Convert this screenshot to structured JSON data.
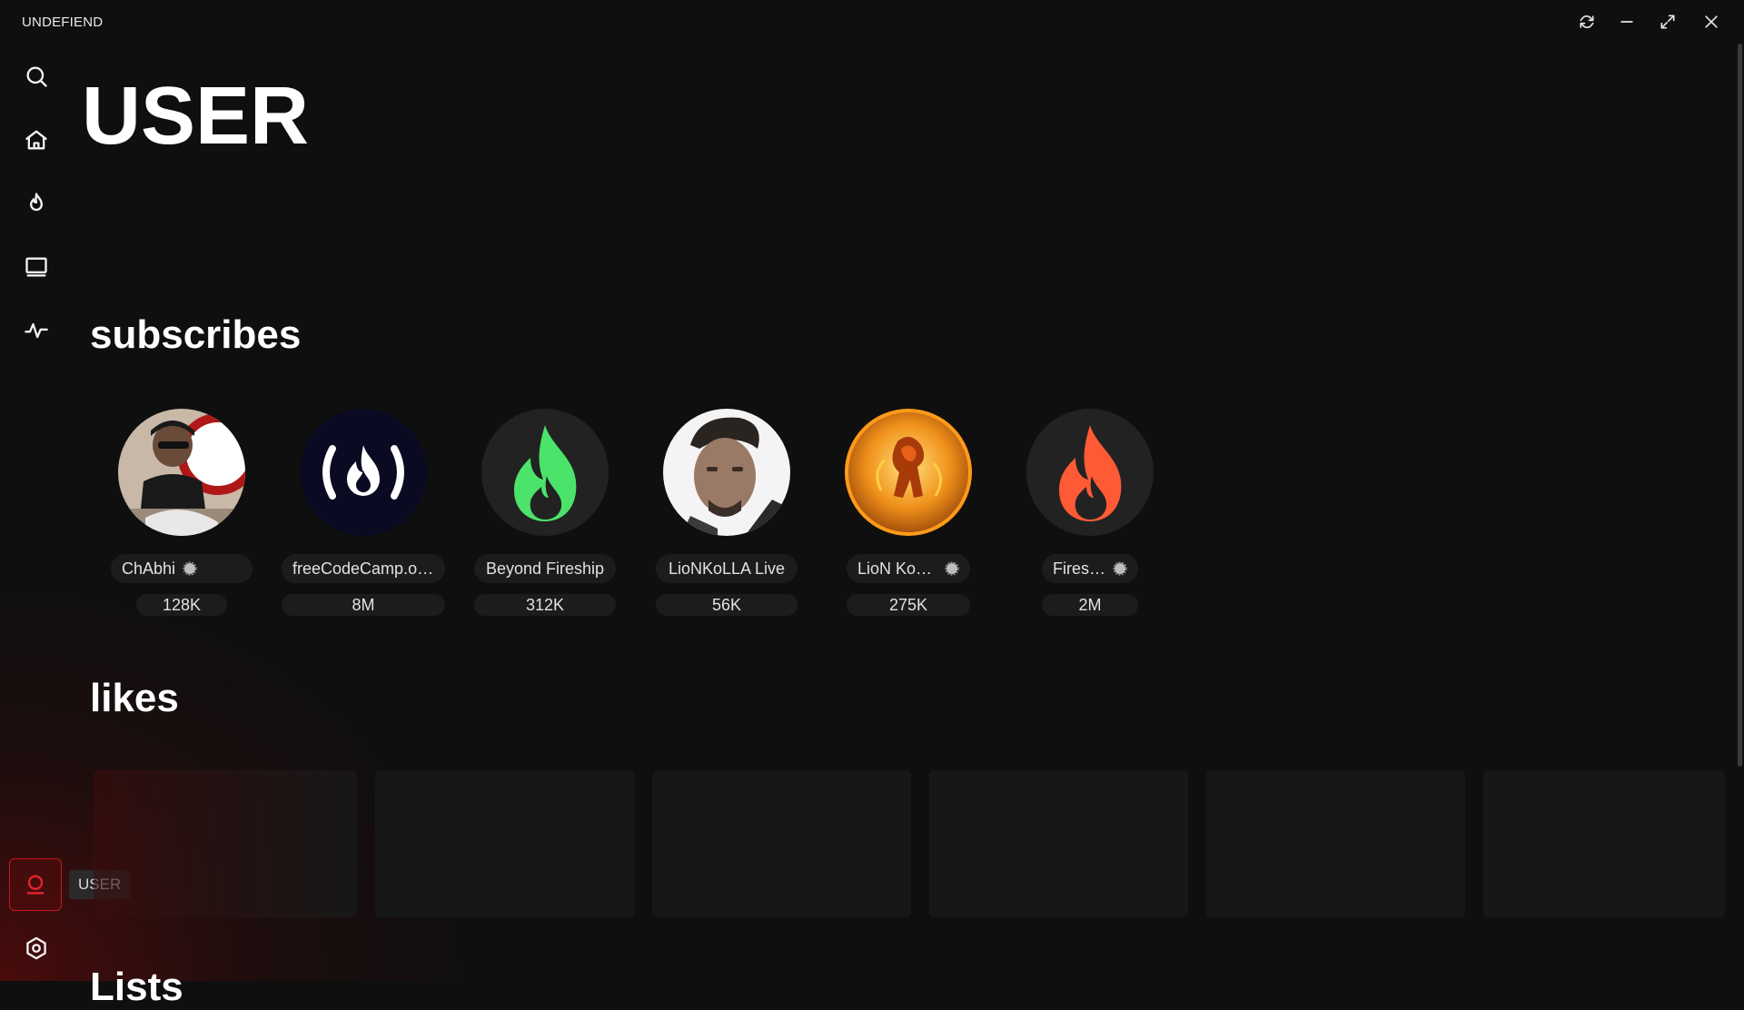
{
  "app": {
    "title": "UNDEFIEND"
  },
  "window_controls": [
    {
      "name": "refresh-icon"
    },
    {
      "name": "minimize-icon"
    },
    {
      "name": "maximize-icon"
    },
    {
      "name": "close-icon"
    }
  ],
  "sidebar": {
    "items": [
      {
        "icon": "search-icon"
      },
      {
        "icon": "home-icon"
      },
      {
        "icon": "flame-icon"
      },
      {
        "icon": "tv-icon"
      },
      {
        "icon": "activity-icon"
      }
    ],
    "bottom": [
      {
        "icon": "user-icon",
        "active": true,
        "tooltip": "USER"
      },
      {
        "icon": "settings-icon"
      }
    ]
  },
  "page": {
    "title": "USER"
  },
  "subscribes": {
    "heading": "subscribes",
    "channels": [
      {
        "name": "ChAbhi",
        "verified": true,
        "subscribers": "128K",
        "avatar": "photo-person-icon",
        "colors": [
          "#d8a070",
          "#6a2a1a"
        ]
      },
      {
        "name": "freeCodeCamp.or...",
        "verified": false,
        "subscribers": "8M",
        "avatar": "freecodecamp-logo-icon",
        "colors": [
          "#0a0a23",
          "#ffffff"
        ]
      },
      {
        "name": "Beyond Fireship",
        "verified": false,
        "subscribers": "312K",
        "avatar": "green-flame-icon",
        "colors": [
          "#222222",
          "#4ce36b"
        ]
      },
      {
        "name": "LioNKoLLA Live",
        "verified": false,
        "subscribers": "56K",
        "avatar": "photo-face-icon",
        "colors": [
          "#f5f5f5",
          "#7a5a48"
        ]
      },
      {
        "name": "LioN KoLLA",
        "verified": true,
        "subscribers": "275K",
        "avatar": "fire-creature-icon",
        "colors": [
          "#e07a10",
          "#ffcc33"
        ]
      },
      {
        "name": "Fireship",
        "verified": true,
        "subscribers": "2M",
        "avatar": "orange-flame-icon",
        "colors": [
          "#222222",
          "#ff5a36"
        ]
      }
    ]
  },
  "likes": {
    "heading": "likes",
    "tile_count": 6
  },
  "lists": {
    "heading": "Lists"
  }
}
